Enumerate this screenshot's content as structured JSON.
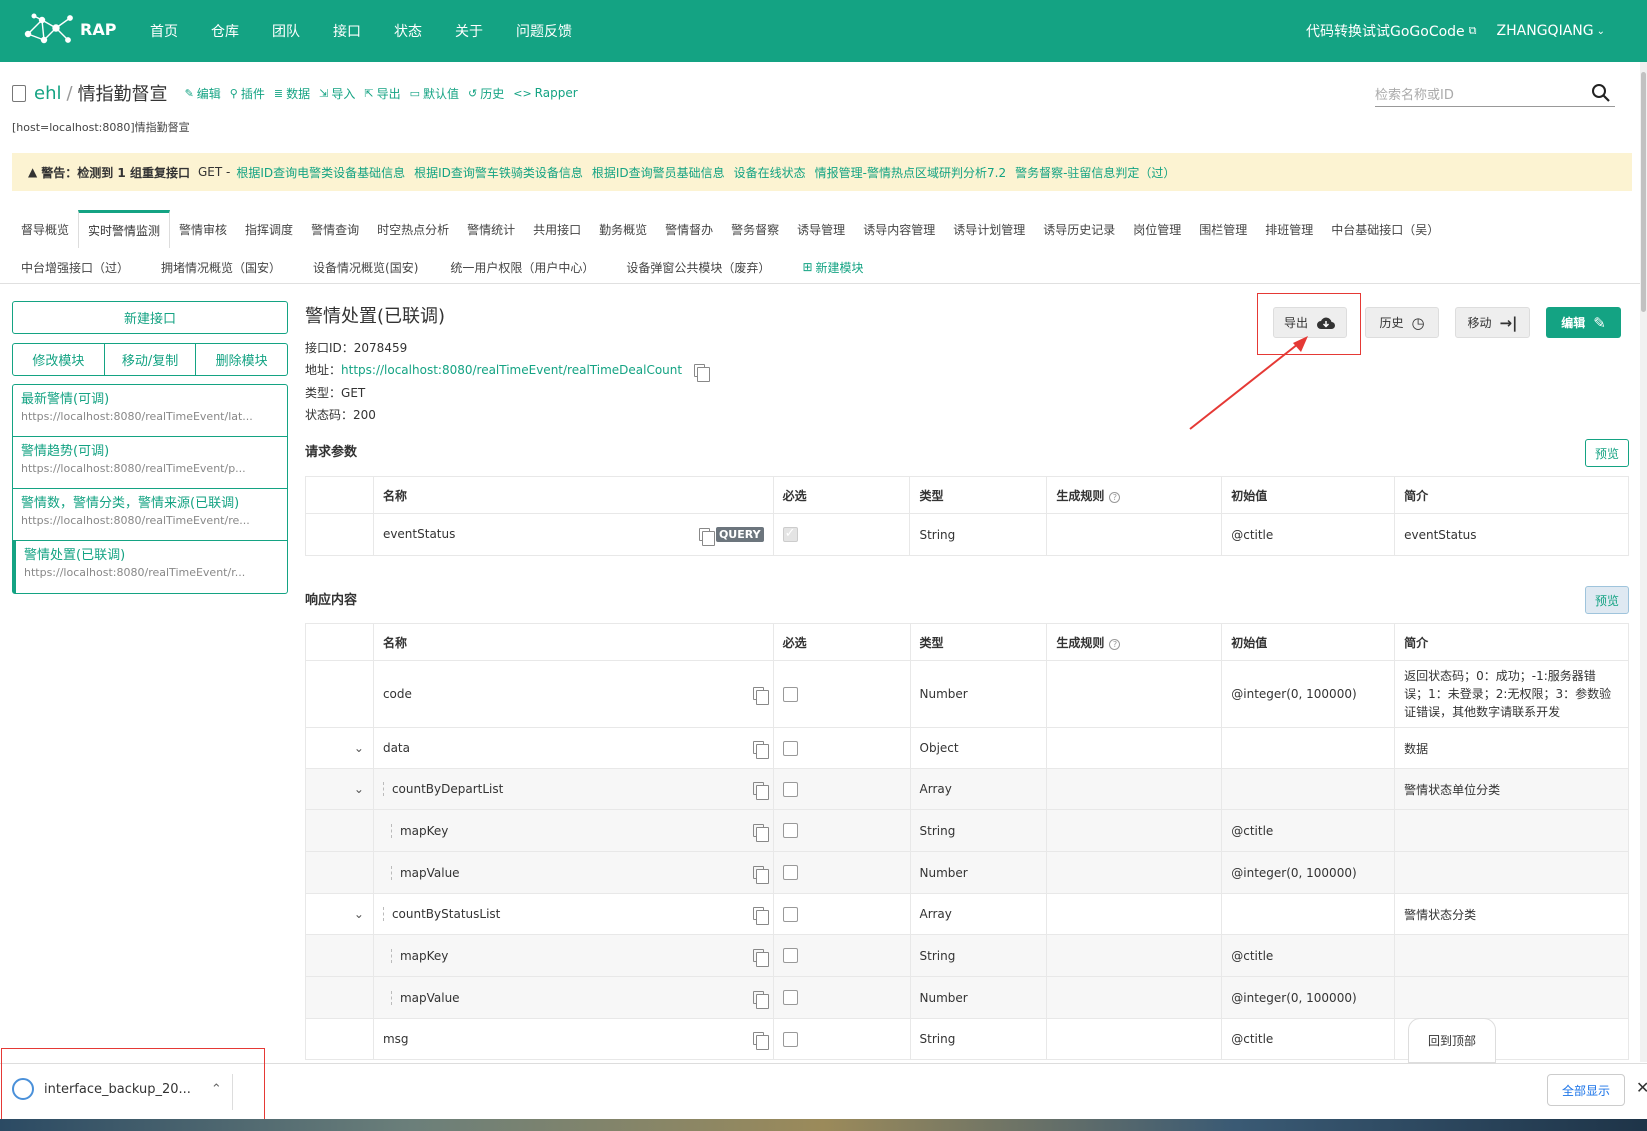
{
  "topnav": {
    "logo": "RAP",
    "items": [
      "首页",
      "仓库",
      "团队",
      "接口",
      "状态",
      "关于",
      "问题反馈"
    ],
    "gogocode": "代码转换试试GoGoCode",
    "user": "ZHANGQIANG"
  },
  "repo": {
    "owner": "ehl",
    "name": "情指勤督宣",
    "actions": [
      "编辑",
      "插件",
      "数据",
      "导入",
      "导出",
      "默认值",
      "历史",
      "Rapper"
    ],
    "host": "[host=localhost:8080]情指勤督宣"
  },
  "search": {
    "placeholder": "检索名称或ID"
  },
  "warning": {
    "title": "警告：检测到 1 组重复接口",
    "method": "GET -",
    "links": [
      "根据ID查询电警类设备基础信息",
      "根据ID查询警车铁骑类设备信息",
      "根据ID查询警员基础信息",
      "设备在线状态",
      "情报管理-警情热点区域研判分析7.2",
      "警务督察-驻留信息判定（过）"
    ]
  },
  "modules_row1": [
    "督导概览",
    "实时警情监测",
    "警情审核",
    "指挥调度",
    "警情查询",
    "时空热点分析",
    "警情统计",
    "共用接口",
    "勤务概览",
    "警情督办",
    "警务督察",
    "诱导管理",
    "诱导内容管理",
    "诱导计划管理",
    "诱导历史记录",
    "岗位管理",
    "围栏管理",
    "排班管理",
    "中台基础接口（吴）"
  ],
  "modules_row2": [
    "中台增强接口（过）",
    "拥堵情况概览（国安）",
    "设备情况概览(国安)",
    "统一用户权限（用户中心）",
    "设备弹窗公共模块（废弃）"
  ],
  "new_module": "新建模块",
  "sidebar": {
    "new_interface": "新建接口",
    "group": [
      "修改模块",
      "移动/复制",
      "删除模块"
    ],
    "interfaces": [
      {
        "name": "最新警情(可调)",
        "url": "https://localhost:8080/realTimeEvent/lat..."
      },
      {
        "name": "警情趋势(可调)",
        "url": "https://localhost:8080/realTimeEvent/p..."
      },
      {
        "name": "警情数，警情分类，警情来源(已联调)",
        "url": "https://localhost:8080/realTimeEvent/re..."
      },
      {
        "name": "警情处置(已联调)",
        "url": "https://localhost:8080/realTimeEvent/r..."
      }
    ]
  },
  "interface": {
    "title": "警情处置(已联调)",
    "id_label": "接口ID：",
    "id": "2078459",
    "addr_label": "地址：",
    "url": "https://localhost:8080/realTimeEvent/realTimeDealCount",
    "type_label": "类型：",
    "type": "GET",
    "status_label": "状态码：",
    "status": "200"
  },
  "buttons": {
    "export": "导出",
    "history": "历史",
    "move": "移动",
    "edit": "编辑"
  },
  "request": {
    "title": "请求参数",
    "preview": "预览",
    "headers": [
      "名称",
      "必选",
      "类型",
      "生成规则",
      "初始值",
      "简介"
    ],
    "rows": [
      {
        "name": "eventStatus",
        "tag": "QUERY",
        "type": "String",
        "init": "@ctitle",
        "desc": "eventStatus"
      }
    ]
  },
  "response": {
    "title": "响应内容",
    "preview": "预览",
    "headers": [
      "名称",
      "必选",
      "类型",
      "生成规则",
      "初始值",
      "简介"
    ],
    "rows": [
      {
        "name": "code",
        "type": "Number",
        "init": "@integer(0, 100000)",
        "desc": "返回状态码；0：成功；-1:服务器错误；1：未登录；2:无权限；3：参数验证错误，其他数字请联系开发"
      },
      {
        "name": "data",
        "type": "Object",
        "init": "",
        "desc": "数据"
      },
      {
        "name": "countByDepartList",
        "type": "Array",
        "init": "",
        "desc": "警情状态单位分类"
      },
      {
        "name": "mapKey",
        "type": "String",
        "init": "@ctitle",
        "desc": ""
      },
      {
        "name": "mapValue",
        "type": "Number",
        "init": "@integer(0, 100000)",
        "desc": ""
      },
      {
        "name": "countByStatusList",
        "type": "Array",
        "init": "",
        "desc": "警情状态分类"
      },
      {
        "name": "mapKey",
        "type": "String",
        "init": "@ctitle",
        "desc": ""
      },
      {
        "name": "mapValue",
        "type": "Number",
        "init": "@integer(0, 100000)",
        "desc": ""
      },
      {
        "name": "msg",
        "type": "String",
        "init": "@ctitle",
        "desc": ""
      }
    ]
  },
  "back_to_top": "回到顶部",
  "download": {
    "file": "interface_backup_20...",
    "show_all": "全部显示"
  },
  "colors": {
    "brand": "#14a383",
    "warning_bg": "#fcf3d2",
    "annotation": "#e53935"
  }
}
